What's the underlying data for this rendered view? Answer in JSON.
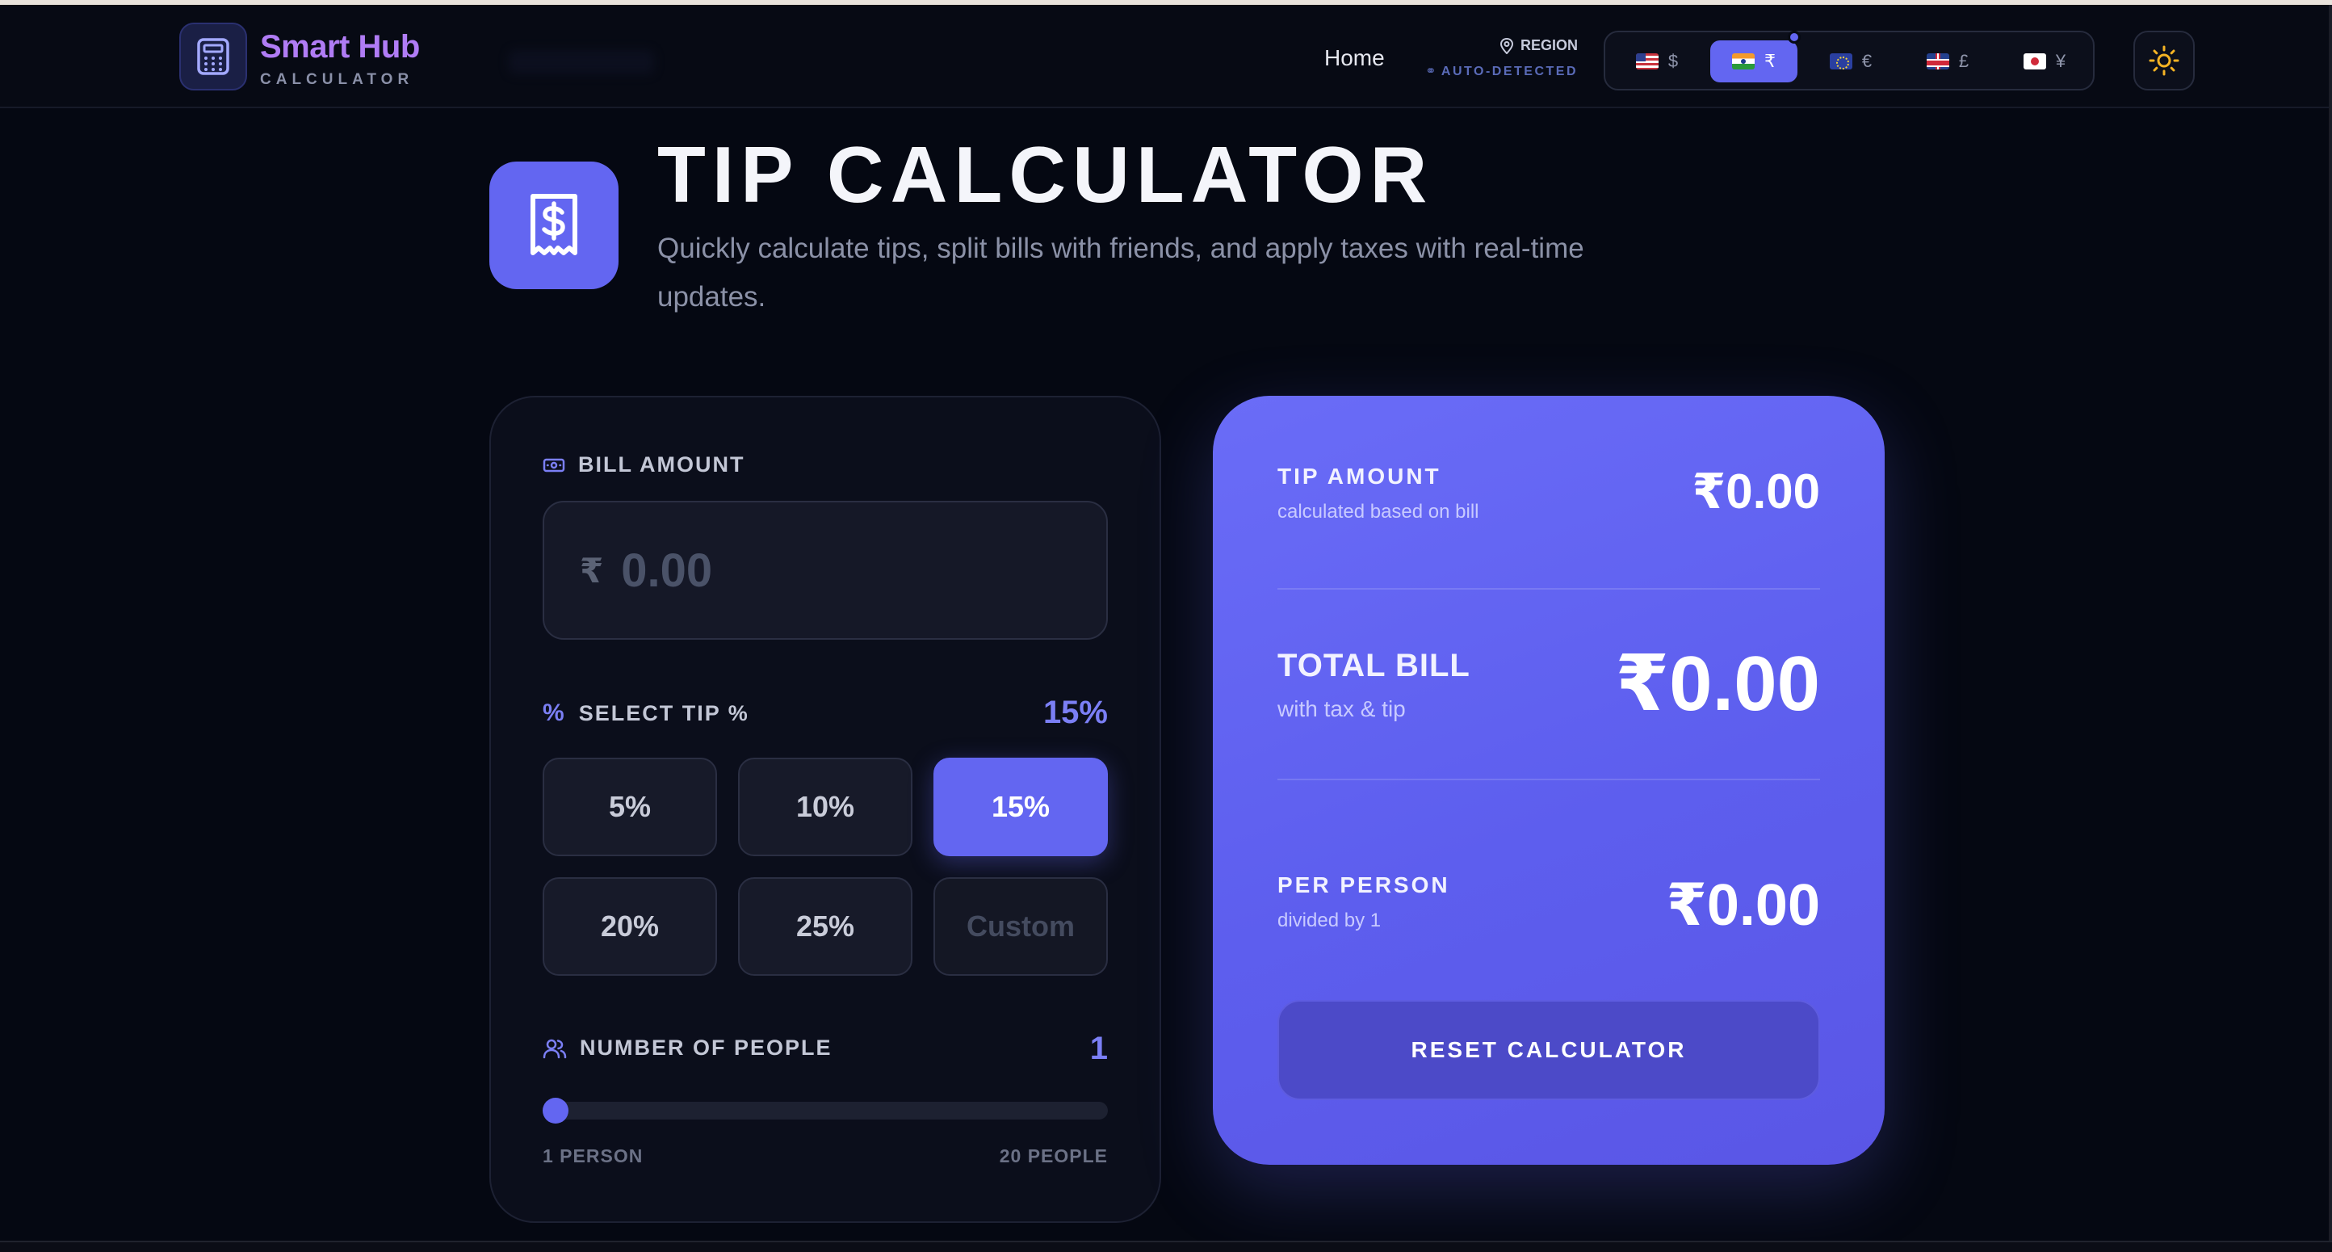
{
  "header": {
    "logo_title": "Smart Hub",
    "logo_subtitle": "CALCULATOR",
    "nav_home": "Home",
    "region_label": "REGION",
    "region_sub": "AUTO-DETECTED",
    "currencies": [
      {
        "flag": "us",
        "symbol": "$",
        "active": false
      },
      {
        "flag": "in",
        "symbol": "₹",
        "active": true
      },
      {
        "flag": "eu",
        "symbol": "€",
        "active": false
      },
      {
        "flag": "gb",
        "symbol": "£",
        "active": false
      },
      {
        "flag": "jp",
        "symbol": "¥",
        "active": false
      }
    ],
    "theme_icon": "sun-icon"
  },
  "hero": {
    "title": "TIP CALCULATOR",
    "subtitle": "Quickly calculate tips, split bills with friends, and apply taxes with real-time updates.",
    "icon": "receipt-dollar-icon"
  },
  "bill": {
    "label": "BILL AMOUNT",
    "currency_symbol": "₹",
    "placeholder": "0.00",
    "value": ""
  },
  "tip": {
    "label": "SELECT TIP %",
    "selected_display": "15%",
    "options": [
      "5%",
      "10%",
      "15%",
      "20%",
      "25%"
    ],
    "selected_index": 2,
    "custom_placeholder": "Custom"
  },
  "people": {
    "label": "NUMBER OF PEOPLE",
    "value": "1",
    "min_label": "1 PERSON",
    "max_label": "20 PEOPLE",
    "min": 1,
    "max": 20,
    "current": 1
  },
  "results": {
    "tip_label": "TIP AMOUNT",
    "tip_sub": "calculated based on bill",
    "tip_value": "₹0.00",
    "total_label": "TOTAL BILL",
    "total_sub": "with tax & tip",
    "total_value": "₹0.00",
    "per_label": "PER PERSON",
    "per_sub": "divided by 1",
    "per_value": "₹0.00",
    "reset_label": "RESET CALCULATOR"
  },
  "colors": {
    "accent": "#6366f1",
    "background": "#050812",
    "panel": "#0b0e1b"
  }
}
